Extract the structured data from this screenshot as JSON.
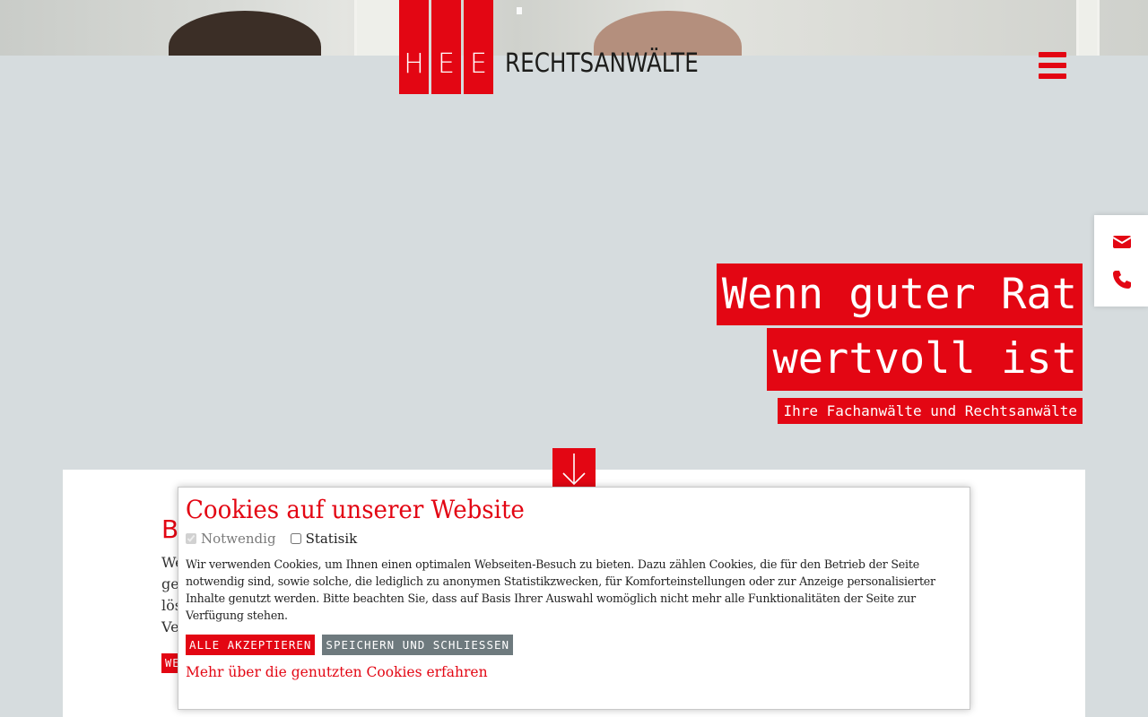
{
  "header": {
    "logo_letters": [
      "H",
      "E",
      "E"
    ],
    "logo_text": "RECHTSANWÄLTE",
    "menu_icon": "hamburger-menu-icon",
    "brand_color": "#e30613"
  },
  "side_contact": {
    "icons": [
      "envelope-icon",
      "phone-icon"
    ]
  },
  "hero": {
    "headline_line1": "Wenn guter Rat",
    "headline_line2": "wertvoll ist",
    "subline": "Ihre Fachanwälte und Rechtsanwälte",
    "scroll_icon": "arrow-down-icon"
  },
  "content": {
    "heading_initial": "B",
    "line_starts": [
      "We",
      "ge",
      "lös",
      "Ve"
    ],
    "button_start": "WE"
  },
  "cookie_banner": {
    "title": "Cookies auf unserer Website",
    "options": [
      {
        "label": "Notwendig",
        "checked": true,
        "disabled": true
      },
      {
        "label": "Statisik",
        "checked": false,
        "disabled": false
      }
    ],
    "text": "Wir verwenden Cookies, um Ihnen einen optimalen Webseiten-Besuch zu bieten. Dazu zählen Cookies, die für den Betrieb der Seite notwendig sind, sowie solche, die lediglich zu anonymen Statistikzwecken, für Komforteinstellungen oder zur Anzeige personalisierter Inhalte genutzt werden. Bitte beachten Sie, dass auf Basis Ihrer Auswahl womöglich nicht mehr alle Funktionalitäten der Seite zur Verfügung stehen.",
    "accept_label": "ALLE AKZEPTIEREN",
    "save_label": "SPEICHERN UND SCHLIESSEN",
    "more_link": "Mehr über die genutzten Cookies erfahren"
  }
}
